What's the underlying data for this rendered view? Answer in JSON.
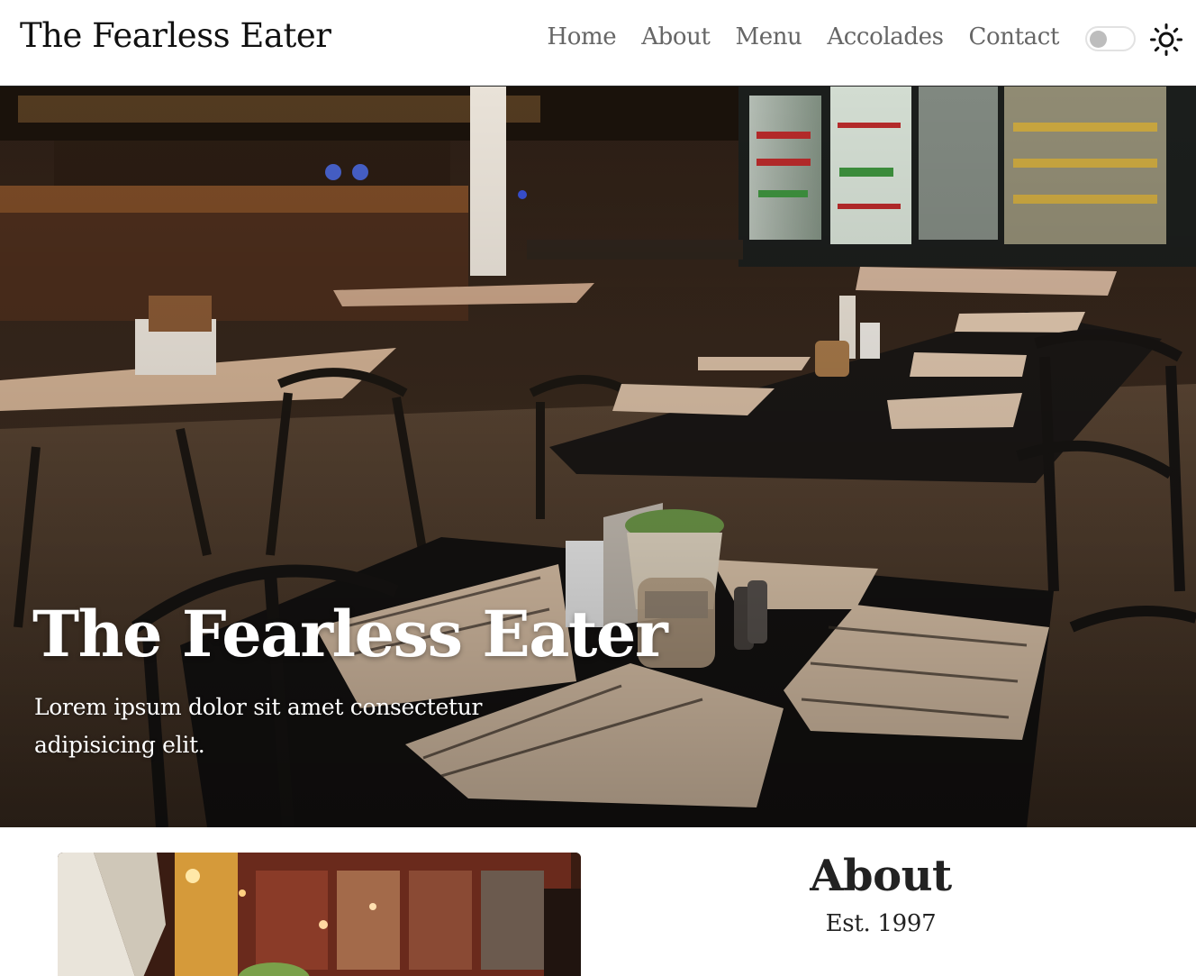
{
  "navbar": {
    "brand": "The Fearless Eater",
    "links": [
      {
        "label": "Home"
      },
      {
        "label": "About"
      },
      {
        "label": "Menu"
      },
      {
        "label": "Accolades"
      },
      {
        "label": "Contact"
      }
    ],
    "theme_toggle": {
      "state": "off"
    },
    "theme_icon": "sun-icon"
  },
  "hero": {
    "title": "The Fearless Eater",
    "text": "Lorem ipsum dolor sit amet consectetur adipisicing elit.",
    "image": "restaurant-interior-photo"
  },
  "about": {
    "heading": "About",
    "established": "Est. 1997",
    "image": "restaurant-photo"
  },
  "colors": {
    "nav_link": "#666666",
    "brand": "#111111",
    "hero_text": "#ffffff"
  }
}
